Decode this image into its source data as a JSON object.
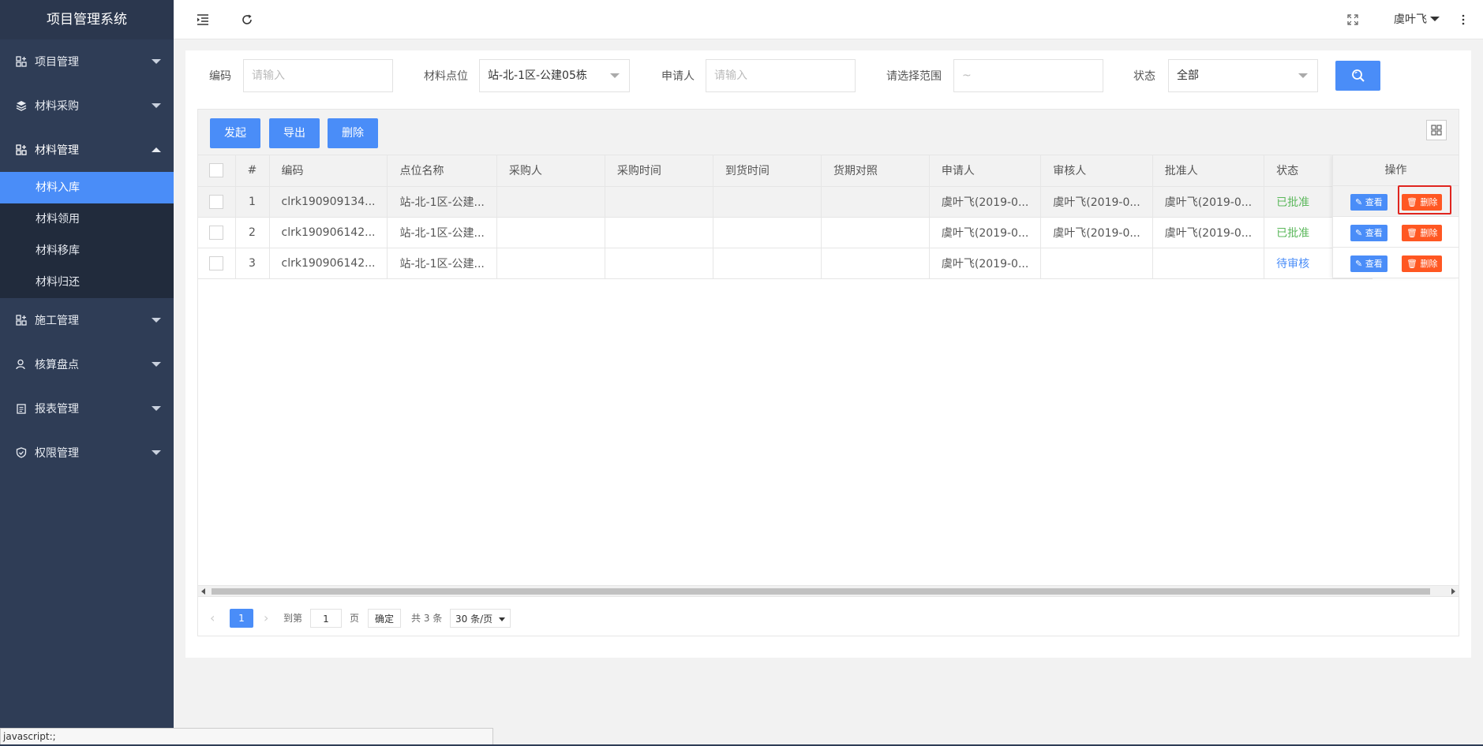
{
  "sidebar": {
    "brand": "项目管理系统",
    "menus": [
      {
        "label": "项目管理",
        "icon": "apps-icon"
      },
      {
        "label": "材料采购",
        "icon": "layers-icon"
      },
      {
        "label": "材料管理",
        "icon": "apps-icon",
        "expanded": true,
        "children": [
          "材料入库",
          "材料领用",
          "材料移库",
          "材料归还"
        ],
        "active_child": "材料入库"
      },
      {
        "label": "施工管理",
        "icon": "apps-icon"
      },
      {
        "label": "核算盘点",
        "icon": "user-icon"
      },
      {
        "label": "报表管理",
        "icon": "clipboard-icon"
      },
      {
        "label": "权限管理",
        "icon": "shield-icon"
      }
    ]
  },
  "topbar": {
    "user": "虞叶飞"
  },
  "filters": {
    "code_label": "编码",
    "code_placeholder": "请输入",
    "site_label": "材料点位",
    "site_value": "站-北-1区-公建05栋",
    "applicant_label": "申请人",
    "applicant_placeholder": "请输入",
    "range_label": "请选择范围",
    "range_placeholder": "~",
    "status_label": "状态",
    "status_value": "全部"
  },
  "toolbar": {
    "start": "发起",
    "export": "导出",
    "delete": "删除"
  },
  "table": {
    "headers": [
      "#",
      "编码",
      "点位名称",
      "采购人",
      "采购时间",
      "到货时间",
      "货期对照",
      "申请人",
      "审核人",
      "批准人",
      "状态"
    ],
    "ops_header": "操作",
    "view_label": "查看",
    "delete_label": "删除",
    "rows": [
      {
        "no": "1",
        "code": "clrk190909134...",
        "site": "站-北-1区-公建...",
        "buyer": "",
        "buy_time": "",
        "arrive_time": "",
        "compare": "",
        "applicant": "虞叶飞(2019-0...",
        "reviewer": "虞叶飞(2019-0...",
        "approver": "虞叶飞(2019-0...",
        "status": "已批准",
        "status_type": "ok"
      },
      {
        "no": "2",
        "code": "clrk190906142...",
        "site": "站-北-1区-公建...",
        "buyer": "",
        "buy_time": "",
        "arrive_time": "",
        "compare": "",
        "applicant": "虞叶飞(2019-0...",
        "reviewer": "虞叶飞(2019-0...",
        "approver": "虞叶飞(2019-0...",
        "status": "已批准",
        "status_type": "ok"
      },
      {
        "no": "3",
        "code": "clrk190906142...",
        "site": "站-北-1区-公建...",
        "buyer": "",
        "buy_time": "",
        "arrive_time": "",
        "compare": "",
        "applicant": "虞叶飞(2019-0...",
        "reviewer": "",
        "approver": "",
        "status": "待审核",
        "status_type": "wait"
      }
    ]
  },
  "pager": {
    "current": "1",
    "goto_label": "到第",
    "goto_value": "1",
    "page_unit": "页",
    "confirm": "确定",
    "total": "共 3 条",
    "page_size": "30 条/页"
  },
  "statusbar": "javascript:;",
  "colors": {
    "sidebar": "#2f3d56",
    "accent": "#4a8df8",
    "danger": "#ff5722",
    "ok": "#5cb85c",
    "highlight": "#e0251f"
  }
}
